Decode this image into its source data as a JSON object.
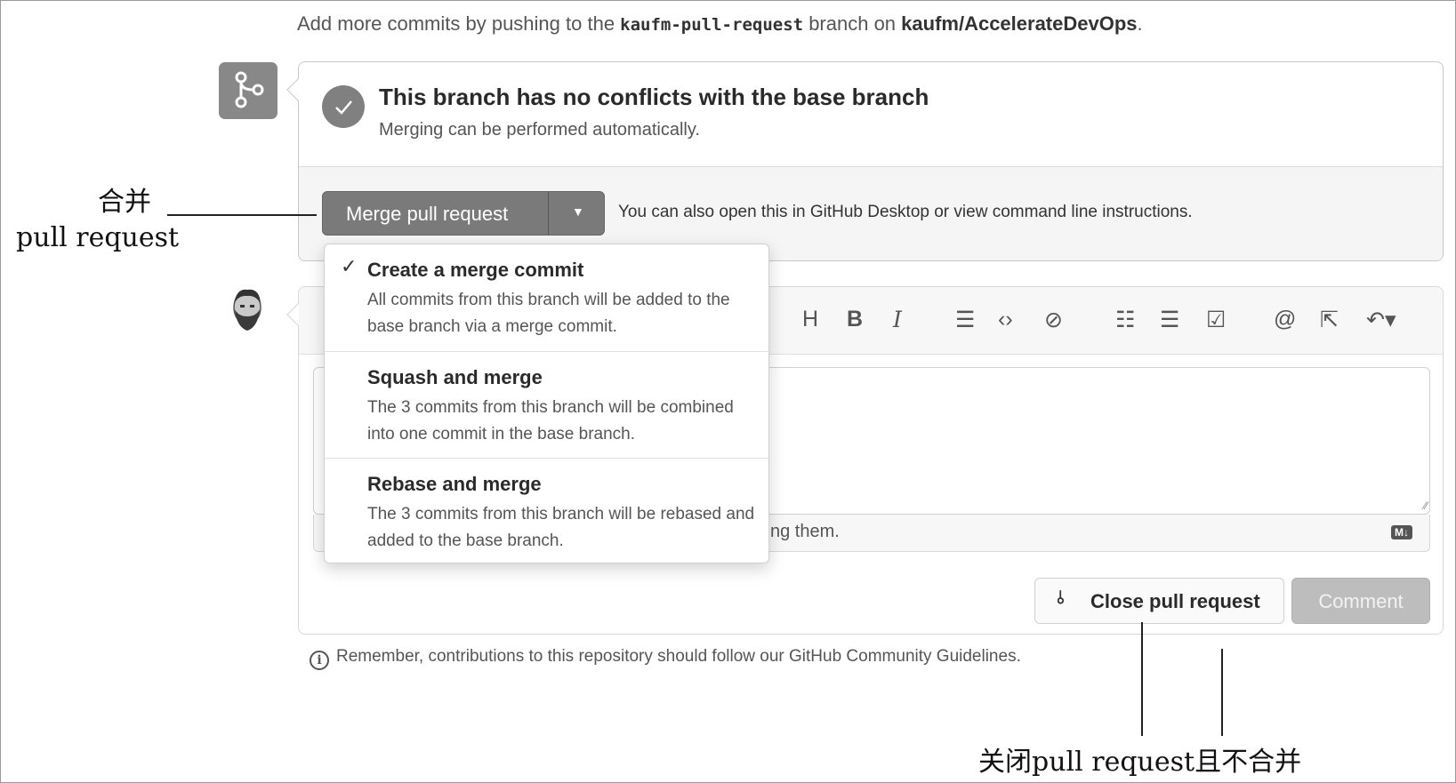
{
  "top_message": {
    "prefix": "Add more commits by pushing to the ",
    "branch": "kaufm-pull-request",
    "middle": " branch on ",
    "repo": "kaufm/AccelerateDevOps",
    "suffix": "."
  },
  "merge_status": {
    "title": "This branch has no conflicts with the base branch",
    "subtitle": "Merging can be performed automatically."
  },
  "merge_button": {
    "label": "Merge pull request"
  },
  "also_text": "You can also open this in GitHub Desktop or view command line instructions.",
  "merge_options": [
    {
      "title": "Create a merge commit",
      "description": "All commits from this branch will be added to the base branch via a merge commit.",
      "selected": true
    },
    {
      "title": "Squash and merge",
      "description": "The 3 commits from this branch will be combined into one commit in the base branch.",
      "selected": false
    },
    {
      "title": "Rebase and merge",
      "description": "The 3 commits from this branch will be rebased and added to the base branch.",
      "selected": false
    }
  ],
  "toolbar": {
    "icons": [
      "heading-icon",
      "bold-icon",
      "italic-icon",
      "quote-icon",
      "code-icon",
      "link-icon",
      "unordered-list-icon",
      "ordered-list-icon",
      "task-list-icon",
      "mention-icon",
      "cross-reference-icon",
      "reply-icon"
    ],
    "heading": "H",
    "bold": "B",
    "italic": "I"
  },
  "comment_footer_text": "sting them.",
  "markdown_badge": "M↓",
  "close_button": {
    "label": "Close pull request"
  },
  "comment_button": {
    "label": "Comment"
  },
  "remember_text": "Remember, contributions to this repository should follow our GitHub Community Guidelines.",
  "annotations": {
    "merge_label_line1": "合并",
    "merge_label_line2": "pull request",
    "close_label": "关闭pull request且不合并"
  }
}
